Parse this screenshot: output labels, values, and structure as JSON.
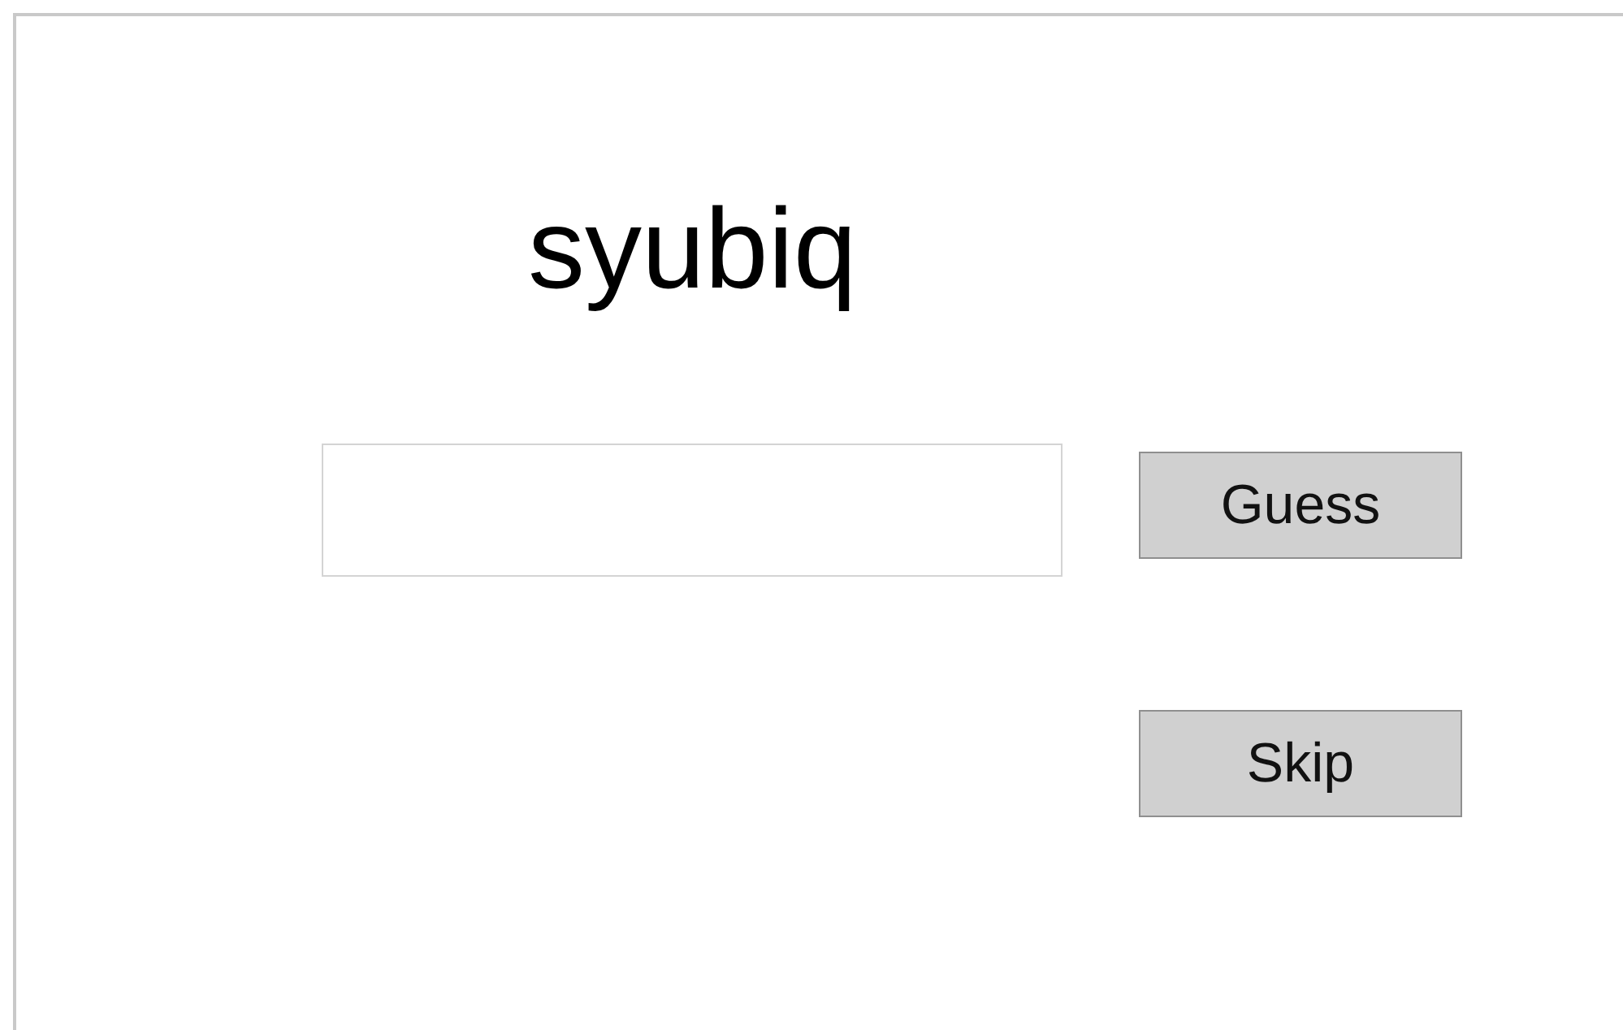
{
  "title": "syubiq",
  "buttons": [
    {
      "label": "Guess",
      "kind": "guess"
    },
    {
      "label": "Skip",
      "kind": "skip"
    }
  ]
}
